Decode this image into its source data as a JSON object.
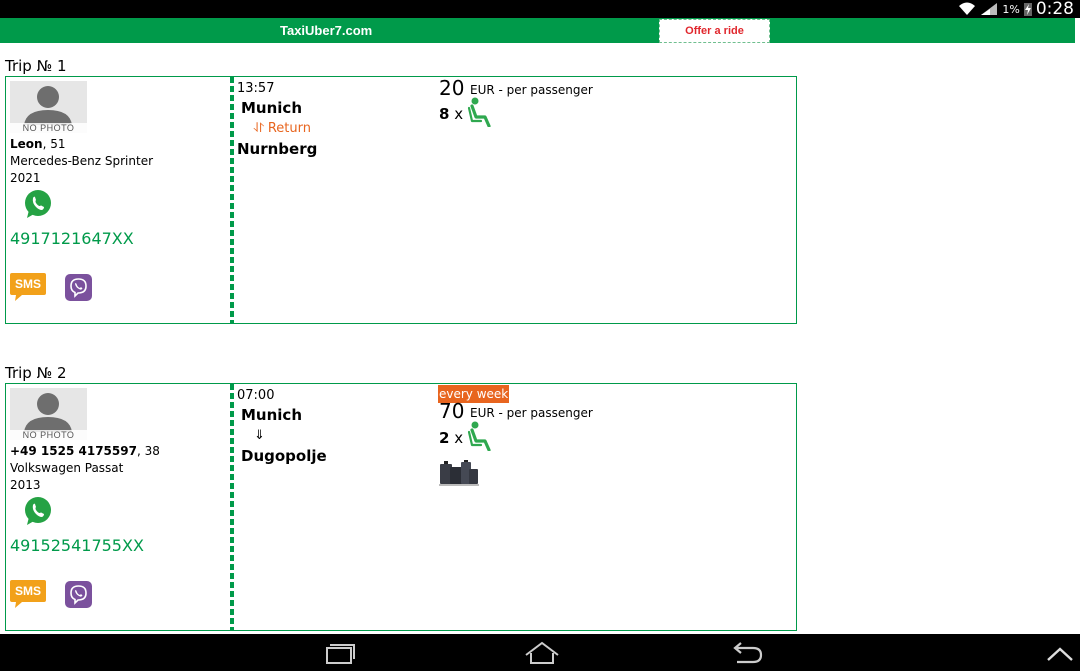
{
  "status_bar": {
    "battery_percent": "1%",
    "clock": "0:28",
    "icons": [
      "wifi-icon",
      "signal-icon",
      "battery-icon",
      "charging-icon"
    ]
  },
  "header": {
    "site_title": "TaxiUber7.com",
    "offer_button": "Offer a ride",
    "colors": {
      "header_bg": "#009a4a",
      "offer_text": "#e0262c"
    }
  },
  "trips": [
    {
      "heading": "Trip № 1",
      "avatar_text": "NO PHOTO",
      "driver_name": "Leon",
      "driver_age": ", 51",
      "car_model": "Mercedes-Benz Sprinter",
      "car_year": "2021",
      "phone": "4917121647XX",
      "sms_label": "SMS",
      "departure_time": "13:57",
      "from": "Munich",
      "route_mid": "⥯ Return",
      "to": "Nurnberg",
      "price": "20",
      "price_unit": "EUR - per passenger",
      "seats_count": "8",
      "seats_x": " x"
    },
    {
      "heading": "Trip № 2",
      "avatar_text": "NO PHOTO",
      "driver_name": "+49 1525 4175597",
      "driver_age": ", 38",
      "car_model": "Volkswagen Passat",
      "car_year": "2013",
      "phone": "49152541755XX",
      "sms_label": "SMS",
      "departure_time": "07:00",
      "from": "Munich",
      "route_mid": "⇓",
      "to": "Dugopolje",
      "schedule_badge": "every week",
      "price": "70",
      "price_unit": "EUR - per passenger",
      "seats_count": "2",
      "seats_x": " x"
    }
  ],
  "icons": {
    "whatsapp": "whatsapp-icon",
    "sms": "sms-icon",
    "viber": "viber-icon",
    "seat": "seat-icon",
    "luggage": "luggage-icon"
  },
  "nav_bar": {
    "buttons": [
      "recent-apps-icon",
      "home-icon",
      "back-icon",
      "chevron-up-icon"
    ]
  }
}
